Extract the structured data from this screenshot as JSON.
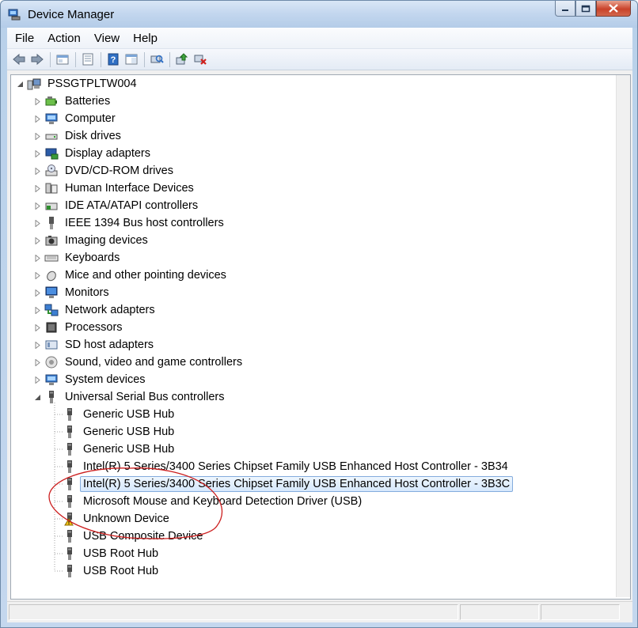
{
  "window": {
    "title": "Device Manager"
  },
  "menu": {
    "file": "File",
    "action": "Action",
    "view": "View",
    "help": "Help"
  },
  "toolbar": {
    "icons": [
      "back-icon",
      "forward-icon",
      "up-icon",
      "properties-icon",
      "help-icon",
      "show-hide-icon",
      "scan-hardware-icon",
      "update-driver-icon",
      "uninstall-icon"
    ]
  },
  "tree": {
    "root": "PSSGTPLTW004",
    "categories": [
      {
        "label": "Batteries",
        "icon": "battery-icon"
      },
      {
        "label": "Computer",
        "icon": "computer-icon"
      },
      {
        "label": "Disk drives",
        "icon": "disk-drive-icon"
      },
      {
        "label": "Display adapters",
        "icon": "display-adapter-icon"
      },
      {
        "label": "DVD/CD-ROM drives",
        "icon": "dvd-drive-icon"
      },
      {
        "label": "Human Interface Devices",
        "icon": "hid-icon"
      },
      {
        "label": "IDE ATA/ATAPI controllers",
        "icon": "ide-controller-icon"
      },
      {
        "label": "IEEE 1394 Bus host controllers",
        "icon": "ieee1394-icon"
      },
      {
        "label": "Imaging devices",
        "icon": "camera-icon"
      },
      {
        "label": "Keyboards",
        "icon": "keyboard-icon"
      },
      {
        "label": "Mice and other pointing devices",
        "icon": "mouse-icon"
      },
      {
        "label": "Monitors",
        "icon": "monitor-icon"
      },
      {
        "label": "Network adapters",
        "icon": "network-icon"
      },
      {
        "label": "Processors",
        "icon": "processor-icon"
      },
      {
        "label": "SD host adapters",
        "icon": "sd-card-icon"
      },
      {
        "label": "Sound, video and game controllers",
        "icon": "speaker-icon"
      },
      {
        "label": "System devices",
        "icon": "system-device-icon"
      },
      {
        "label": "Universal Serial Bus controllers",
        "icon": "usb-icon"
      }
    ],
    "usb_children": [
      {
        "label": "Generic USB Hub"
      },
      {
        "label": "Generic USB Hub"
      },
      {
        "label": "Generic USB Hub"
      },
      {
        "label": "Intel(R) 5 Series/3400 Series Chipset Family USB Enhanced Host Controller - 3B34"
      },
      {
        "label": "Intel(R) 5 Series/3400 Series Chipset Family USB Enhanced Host Controller - 3B3C",
        "selected": true
      },
      {
        "label": "Microsoft Mouse and Keyboard Detection Driver (USB)"
      },
      {
        "label": "Unknown Device",
        "warning": true
      },
      {
        "label": "USB Composite Device"
      },
      {
        "label": "USB Root Hub"
      },
      {
        "label": "USB Root Hub"
      }
    ]
  },
  "annotation": {
    "color": "#cc1f1f"
  }
}
